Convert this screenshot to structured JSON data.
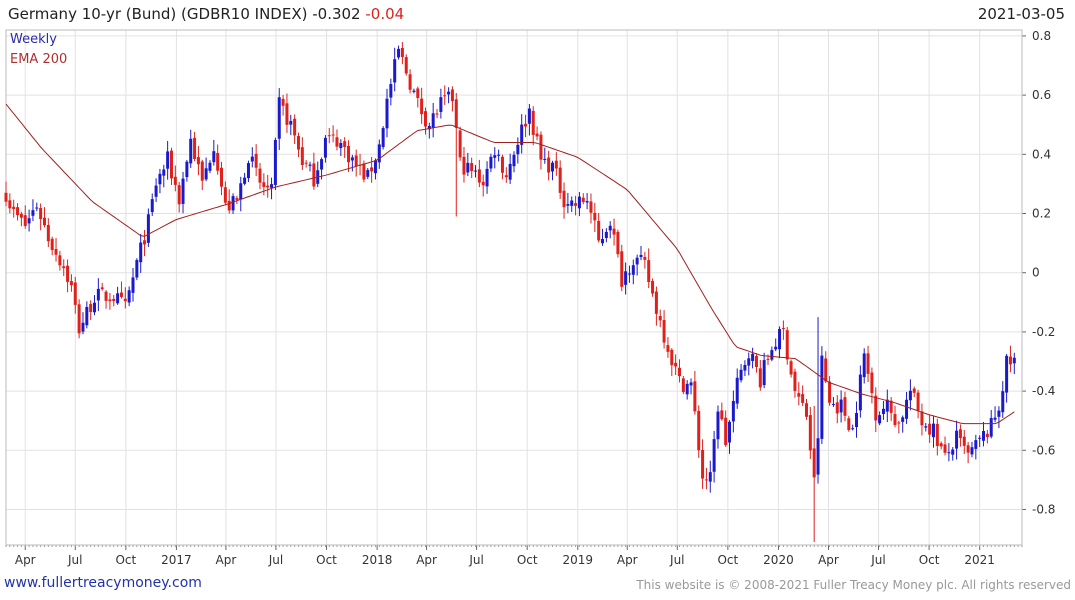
{
  "header": {
    "title": "Germany 10-yr (Bund)  (GDBR10 INDEX)",
    "last_value": "-0.302",
    "change": "-0.04",
    "date": "2021-03-05"
  },
  "footer": {
    "site": "www.fullertreacymoney.com",
    "copyright": "This website is © 2008-2021 Fuller Treacy Money plc. All rights reserved"
  },
  "colors": {
    "up": "#1a1acc",
    "down": "#e0201a",
    "ema": "#a02020",
    "grid": "#e2e2e2",
    "axis": "#666666"
  },
  "chart_data": {
    "type": "candlestick",
    "frequency": "Weekly",
    "legend": [
      "Weekly",
      "EMA 200"
    ],
    "ylim": [
      -0.92,
      0.82
    ],
    "yticks": [
      0.8,
      0.6,
      0.4,
      0.2,
      0,
      -0.2,
      -0.4,
      -0.6,
      -0.8
    ],
    "ytick_labels": [
      "0.8",
      "0.6",
      "0.4",
      "0.2",
      "0",
      "-0.2",
      "-0.4",
      "-0.6",
      "-0.8"
    ],
    "xlim": [
      "2016-02-26",
      "2021-03-19"
    ],
    "xticks": [
      {
        "date": "2016-04-01",
        "label": "Apr"
      },
      {
        "date": "2016-07-01",
        "label": "Jul"
      },
      {
        "date": "2016-10-01",
        "label": "Oct"
      },
      {
        "date": "2017-01-01",
        "label": "2017"
      },
      {
        "date": "2017-04-01",
        "label": "Apr"
      },
      {
        "date": "2017-07-01",
        "label": "Jul"
      },
      {
        "date": "2017-10-01",
        "label": "Oct"
      },
      {
        "date": "2018-01-01",
        "label": "2018"
      },
      {
        "date": "2018-04-01",
        "label": "Apr"
      },
      {
        "date": "2018-07-01",
        "label": "Jul"
      },
      {
        "date": "2018-10-01",
        "label": "Oct"
      },
      {
        "date": "2019-01-01",
        "label": "2019"
      },
      {
        "date": "2019-04-01",
        "label": "Apr"
      },
      {
        "date": "2019-07-01",
        "label": "Jul"
      },
      {
        "date": "2019-10-01",
        "label": "Oct"
      },
      {
        "date": "2020-01-01",
        "label": "2020"
      },
      {
        "date": "2020-04-01",
        "label": "Apr"
      },
      {
        "date": "2020-07-01",
        "label": "Jul"
      },
      {
        "date": "2020-10-01",
        "label": "Oct"
      },
      {
        "date": "2021-01-01",
        "label": "2021"
      }
    ],
    "close_anchors": [
      [
        "2016-02-26",
        0.27
      ],
      [
        "2016-03-11",
        0.2
      ],
      [
        "2016-04-01",
        0.16
      ],
      [
        "2016-04-22",
        0.23
      ],
      [
        "2016-05-13",
        0.12
      ],
      [
        "2016-06-10",
        0.02
      ],
      [
        "2016-06-24",
        -0.05
      ],
      [
        "2016-07-08",
        -0.19
      ],
      [
        "2016-08-05",
        -0.08
      ],
      [
        "2016-09-09",
        -0.08
      ],
      [
        "2016-09-30",
        -0.12
      ],
      [
        "2016-10-21",
        0.03
      ],
      [
        "2016-11-11",
        0.17
      ],
      [
        "2016-11-25",
        0.3
      ],
      [
        "2016-12-16",
        0.38
      ],
      [
        "2017-01-06",
        0.25
      ],
      [
        "2017-01-27",
        0.45
      ],
      [
        "2017-02-17",
        0.3
      ],
      [
        "2017-03-10",
        0.44
      ],
      [
        "2017-03-31",
        0.22
      ],
      [
        "2017-04-21",
        0.24
      ],
      [
        "2017-05-12",
        0.4
      ],
      [
        "2017-06-02",
        0.3
      ],
      [
        "2017-06-23",
        0.27
      ],
      [
        "2017-07-07",
        0.57
      ],
      [
        "2017-07-28",
        0.5
      ],
      [
        "2017-08-18",
        0.38
      ],
      [
        "2017-09-08",
        0.32
      ],
      [
        "2017-09-29",
        0.45
      ],
      [
        "2017-10-20",
        0.45
      ],
      [
        "2017-11-10",
        0.4
      ],
      [
        "2017-11-24",
        0.36
      ],
      [
        "2017-12-15",
        0.32
      ],
      [
        "2018-01-05",
        0.43
      ],
      [
        "2018-01-19",
        0.58
      ],
      [
        "2018-02-09",
        0.75
      ],
      [
        "2018-02-23",
        0.68
      ],
      [
        "2018-03-16",
        0.57
      ],
      [
        "2018-04-06",
        0.5
      ],
      [
        "2018-04-27",
        0.57
      ],
      [
        "2018-05-18",
        0.59
      ],
      [
        "2018-06-01",
        0.37
      ],
      [
        "2018-06-22",
        0.34
      ],
      [
        "2018-07-13",
        0.31
      ],
      [
        "2018-08-03",
        0.42
      ],
      [
        "2018-08-24",
        0.33
      ],
      [
        "2018-09-14",
        0.45
      ],
      [
        "2018-10-05",
        0.55
      ],
      [
        "2018-10-26",
        0.38
      ],
      [
        "2018-11-16",
        0.36
      ],
      [
        "2018-12-07",
        0.25
      ],
      [
        "2018-12-28",
        0.23
      ],
      [
        "2019-01-18",
        0.25
      ],
      [
        "2019-02-08",
        0.1
      ],
      [
        "2019-03-01",
        0.18
      ],
      [
        "2019-03-22",
        -0.02
      ],
      [
        "2019-04-12",
        0.05
      ],
      [
        "2019-05-03",
        0.02
      ],
      [
        "2019-05-24",
        -0.12
      ],
      [
        "2019-06-14",
        -0.25
      ],
      [
        "2019-07-05",
        -0.37
      ],
      [
        "2019-07-26",
        -0.38
      ],
      [
        "2019-08-16",
        -0.69
      ],
      [
        "2019-08-30",
        -0.7
      ],
      [
        "2019-09-13",
        -0.45
      ],
      [
        "2019-09-27",
        -0.57
      ],
      [
        "2019-10-18",
        -0.38
      ],
      [
        "2019-11-08",
        -0.26
      ],
      [
        "2019-11-29",
        -0.36
      ],
      [
        "2019-12-20",
        -0.25
      ],
      [
        "2020-01-10",
        -0.2
      ],
      [
        "2020-01-31",
        -0.4
      ],
      [
        "2020-02-21",
        -0.48
      ],
      [
        "2020-03-06",
        -0.71
      ],
      [
        "2020-03-13",
        -0.55
      ],
      [
        "2020-03-20",
        -0.3
      ],
      [
        "2020-04-03",
        -0.44
      ],
      [
        "2020-04-24",
        -0.45
      ],
      [
        "2020-05-15",
        -0.53
      ],
      [
        "2020-06-05",
        -0.28
      ],
      [
        "2020-06-26",
        -0.47
      ],
      [
        "2020-07-17",
        -0.45
      ],
      [
        "2020-08-07",
        -0.51
      ],
      [
        "2020-08-28",
        -0.4
      ],
      [
        "2020-09-18",
        -0.5
      ],
      [
        "2020-10-09",
        -0.53
      ],
      [
        "2020-10-30",
        -0.63
      ],
      [
        "2020-11-20",
        -0.56
      ],
      [
        "2020-12-11",
        -0.62
      ],
      [
        "2021-01-01",
        -0.57
      ],
      [
        "2021-01-22",
        -0.52
      ],
      [
        "2021-02-05",
        -0.45
      ],
      [
        "2021-02-19",
        -0.31
      ],
      [
        "2021-03-05",
        -0.3
      ]
    ],
    "ema_anchors": [
      [
        "2016-02-26",
        0.57
      ],
      [
        "2016-05-01",
        0.42
      ],
      [
        "2016-08-01",
        0.24
      ],
      [
        "2016-11-01",
        0.12
      ],
      [
        "2017-01-01",
        0.18
      ],
      [
        "2017-04-01",
        0.23
      ],
      [
        "2017-07-01",
        0.29
      ],
      [
        "2017-10-01",
        0.33
      ],
      [
        "2018-01-01",
        0.38
      ],
      [
        "2018-03-15",
        0.48
      ],
      [
        "2018-05-15",
        0.5
      ],
      [
        "2018-08-01",
        0.44
      ],
      [
        "2018-10-15",
        0.44
      ],
      [
        "2019-01-01",
        0.39
      ],
      [
        "2019-04-01",
        0.28
      ],
      [
        "2019-07-01",
        0.08
      ],
      [
        "2019-09-01",
        -0.12
      ],
      [
        "2019-10-15",
        -0.25
      ],
      [
        "2019-12-01",
        -0.28
      ],
      [
        "2020-02-01",
        -0.29
      ],
      [
        "2020-04-01",
        -0.37
      ],
      [
        "2020-06-01",
        -0.41
      ],
      [
        "2020-08-01",
        -0.44
      ],
      [
        "2020-10-01",
        -0.48
      ],
      [
        "2020-12-01",
        -0.51
      ],
      [
        "2021-02-01",
        -0.51
      ],
      [
        "2021-03-05",
        -0.47
      ]
    ],
    "notable_wicks": [
      [
        "2018-05-25",
        0.19,
        0.45
      ],
      [
        "2020-03-06",
        -0.91,
        -0.45
      ],
      [
        "2020-03-13",
        -0.62,
        -0.15
      ]
    ]
  }
}
